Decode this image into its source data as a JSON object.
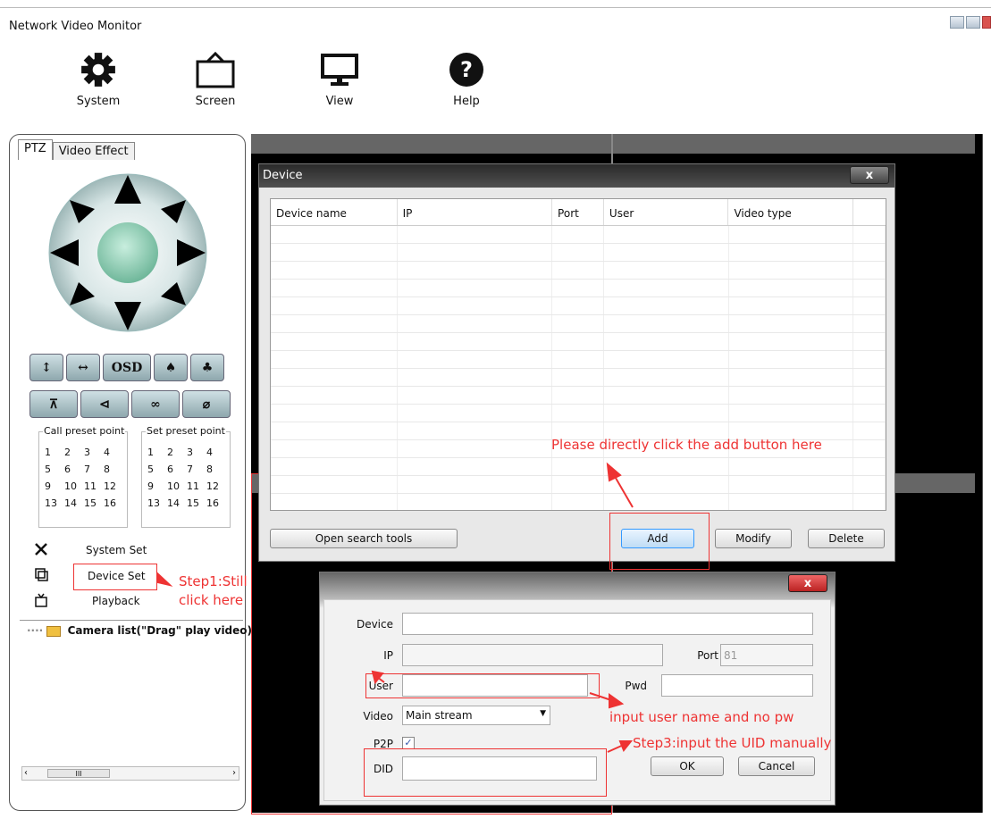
{
  "app": {
    "title": "Network Video Monitor"
  },
  "toolbar": {
    "system": "System",
    "screen": "Screen",
    "view": "View",
    "help": "Help"
  },
  "left_panel": {
    "tabs": [
      "PTZ",
      "Video Effect"
    ],
    "ptz_row1_label": "OSD",
    "call_preset": {
      "title": "Call preset point",
      "points": [
        "1",
        "2",
        "3",
        "4",
        "5",
        "6",
        "7",
        "8",
        "9",
        "10",
        "11",
        "12",
        "13",
        "14",
        "15",
        "16"
      ]
    },
    "set_preset": {
      "title": "Set preset point",
      "points": [
        "1",
        "2",
        "3",
        "4",
        "5",
        "6",
        "7",
        "8",
        "9",
        "10",
        "11",
        "12",
        "13",
        "14",
        "15",
        "16"
      ]
    },
    "menu": {
      "system_set": "System Set",
      "device_set": "Device Set",
      "playback": "Playback"
    },
    "camera_list": "Camera list(\"Drag\" play video)",
    "scroll_thumb": "III"
  },
  "device_dialog": {
    "title": "Device",
    "close": "x",
    "columns": [
      "Device name",
      "IP",
      "Port",
      "User",
      "Video type"
    ],
    "buttons": {
      "search": "Open search tools",
      "add": "Add",
      "modify": "Modify",
      "delete": "Delete"
    }
  },
  "add_dialog": {
    "close": "x",
    "labels": {
      "device": "Device",
      "ip": "IP",
      "port": "Port",
      "user": "User",
      "pwd": "Pwd",
      "video": "Video",
      "p2p": "P2P",
      "did": "DID"
    },
    "values": {
      "port": "81",
      "video": "Main stream",
      "p2p_checked": true
    },
    "buttons": {
      "ok": "OK",
      "cancel": "Cancel"
    }
  },
  "annotations": {
    "add_hint": "Please directly click the add button here",
    "step1_line1": "Step1:Still",
    "step1_line2": "click here",
    "user_hint": "input user name and no pw",
    "step3": "Step3:input the UID manually"
  },
  "colors": {
    "annotation": "#ee3333",
    "video_bg": "#000000",
    "title_bar": "#333333"
  }
}
